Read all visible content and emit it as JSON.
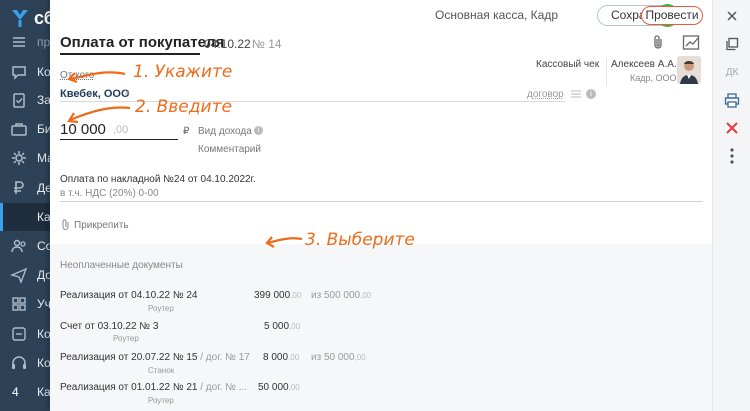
{
  "sidebar": {
    "brand": "сб",
    "items": [
      {
        "icon": "menu-icon",
        "label": "пр"
      },
      {
        "icon": "chat-icon",
        "label": "Ко"
      },
      {
        "icon": "clipboard-icon",
        "label": "За"
      },
      {
        "icon": "briefcase-icon",
        "label": "Би"
      },
      {
        "icon": "gear-icon",
        "label": "Ма"
      },
      {
        "icon": "ruble-icon",
        "label": "Де"
      },
      {
        "icon": "",
        "label": "Ка"
      },
      {
        "icon": "people-icon",
        "label": "Со"
      },
      {
        "icon": "send-icon",
        "label": "До"
      },
      {
        "icon": "grid-icon",
        "label": "Уч"
      },
      {
        "icon": "tag-icon",
        "label": "Ко"
      },
      {
        "icon": "headset-icon",
        "label": "Ко"
      },
      {
        "icon": "",
        "label": "Ка"
      }
    ],
    "badge": "4"
  },
  "header": {
    "cash_desk": "Основная касса, Кадр",
    "save_label": "Сохранить",
    "post_label": "Провести"
  },
  "document": {
    "title": "Оплата от покупателя",
    "date": "04.10.22",
    "number": "№ 14"
  },
  "form": {
    "from_label": "От кого",
    "receipt_label": "Кассовый чек",
    "responsible": "Алексеев А.А.",
    "responsible_org": "Кадр, ООО",
    "contractor": "Квебек, ООО",
    "contractor_clear": "×",
    "contract_label": "договор",
    "amount": "10 000",
    "amount_decimals": ",00",
    "currency": "₽",
    "income_type": "Вид дохода",
    "comment": "Комментарий",
    "purpose": "Оплата по накладной №24 от 04.10.2022г.",
    "vat": "в т.ч. НДС (20%)  0-00",
    "attach_label": "Прикрепить"
  },
  "unpaid": {
    "title": "Неоплаченные документы",
    "docs": [
      {
        "name": "Реализация от 04.10.22 № 24",
        "contract": "",
        "sub": "Роутер",
        "sum": "399 000",
        "sum_dec": ",00",
        "of": "из 500 000",
        "of_dec": ",00"
      },
      {
        "name": "Счет от 03.10.22 № 3",
        "contract": "",
        "sub": "Роутер",
        "sum": "5 000",
        "sum_dec": ",00",
        "of": "",
        "of_dec": ""
      },
      {
        "name": "Реализация от 20.07.22 № 15",
        "contract": " / дог. № 17",
        "sub": "Станок",
        "sum": "8 000",
        "sum_dec": ",00",
        "of": "из 50 000",
        "of_dec": ",00"
      },
      {
        "name": "Реализация от 01.01.22 № 21",
        "contract": " / дог. № ...",
        "sub": "Роутер",
        "sum": "50 000",
        "sum_dec": ",00",
        "of": "",
        "of_dec": ""
      }
    ]
  },
  "rightbar": {
    "dk_label": "ДК"
  },
  "annotations": {
    "step1": "1. Укажите",
    "step2": "2. Введите",
    "step3": "3. Выберите"
  },
  "colors": {
    "accent_orange": "#ee6b1a",
    "sidebar_bg": "#2e4257",
    "save_check": "#38b449",
    "post_border": "#e9583f",
    "delete_red": "#e33b3b"
  }
}
